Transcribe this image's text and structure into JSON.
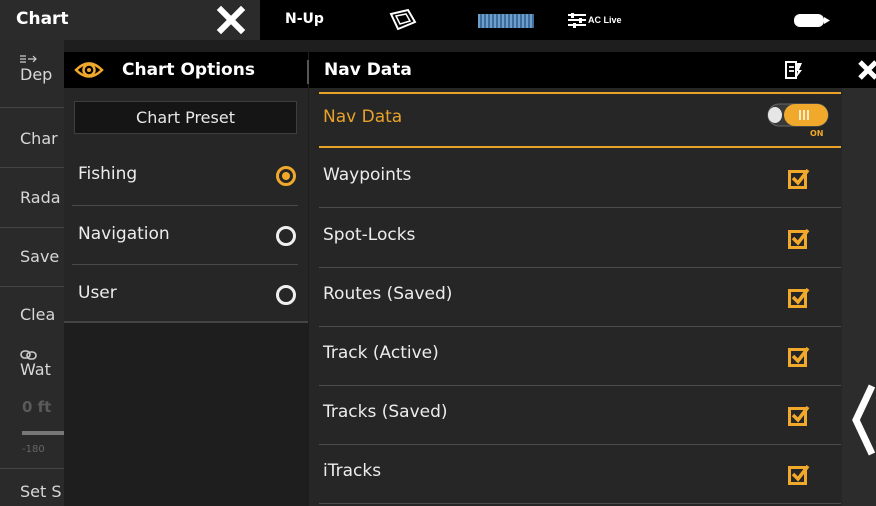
{
  "topbar": {
    "title": "Chart",
    "view_mode": "N-Up",
    "aclive_label": "AC Live"
  },
  "left_menu": {
    "items": [
      {
        "label": "Dep"
      },
      {
        "label": "Char"
      },
      {
        "label": "Rada"
      },
      {
        "label": "Save"
      },
      {
        "label": "Clea"
      },
      {
        "label": "Wat"
      },
      {
        "label": "Set S"
      }
    ],
    "value": "0 ft",
    "slider_min": "-180"
  },
  "chart_options": {
    "title": "Chart Options",
    "preset_button": "Chart Preset",
    "presets": [
      {
        "label": "Fishing",
        "selected": true
      },
      {
        "label": "Navigation",
        "selected": false
      },
      {
        "label": "User",
        "selected": false
      }
    ]
  },
  "nav_data": {
    "title": "Nav Data",
    "toggle_row": {
      "label": "Nav Data",
      "state": "ON"
    },
    "items": [
      {
        "label": "Waypoints",
        "checked": true
      },
      {
        "label": "Spot-Locks",
        "checked": true
      },
      {
        "label": "Routes (Saved)",
        "checked": true
      },
      {
        "label": "Track (Active)",
        "checked": true
      },
      {
        "label": "Tracks (Saved)",
        "checked": true
      },
      {
        "label": "iTracks",
        "checked": true
      }
    ]
  },
  "colors": {
    "accent": "#E8A22A",
    "panel_bg": "#262626",
    "header_bg": "#000000"
  },
  "icons": [
    "close-icon",
    "boat-icon",
    "aclive-icon",
    "battery-icon",
    "eye-icon",
    "back-icon",
    "checkbox-icon",
    "toggle-icon",
    "chevron-left-icon",
    "link-icon",
    "arrows-icon"
  ]
}
